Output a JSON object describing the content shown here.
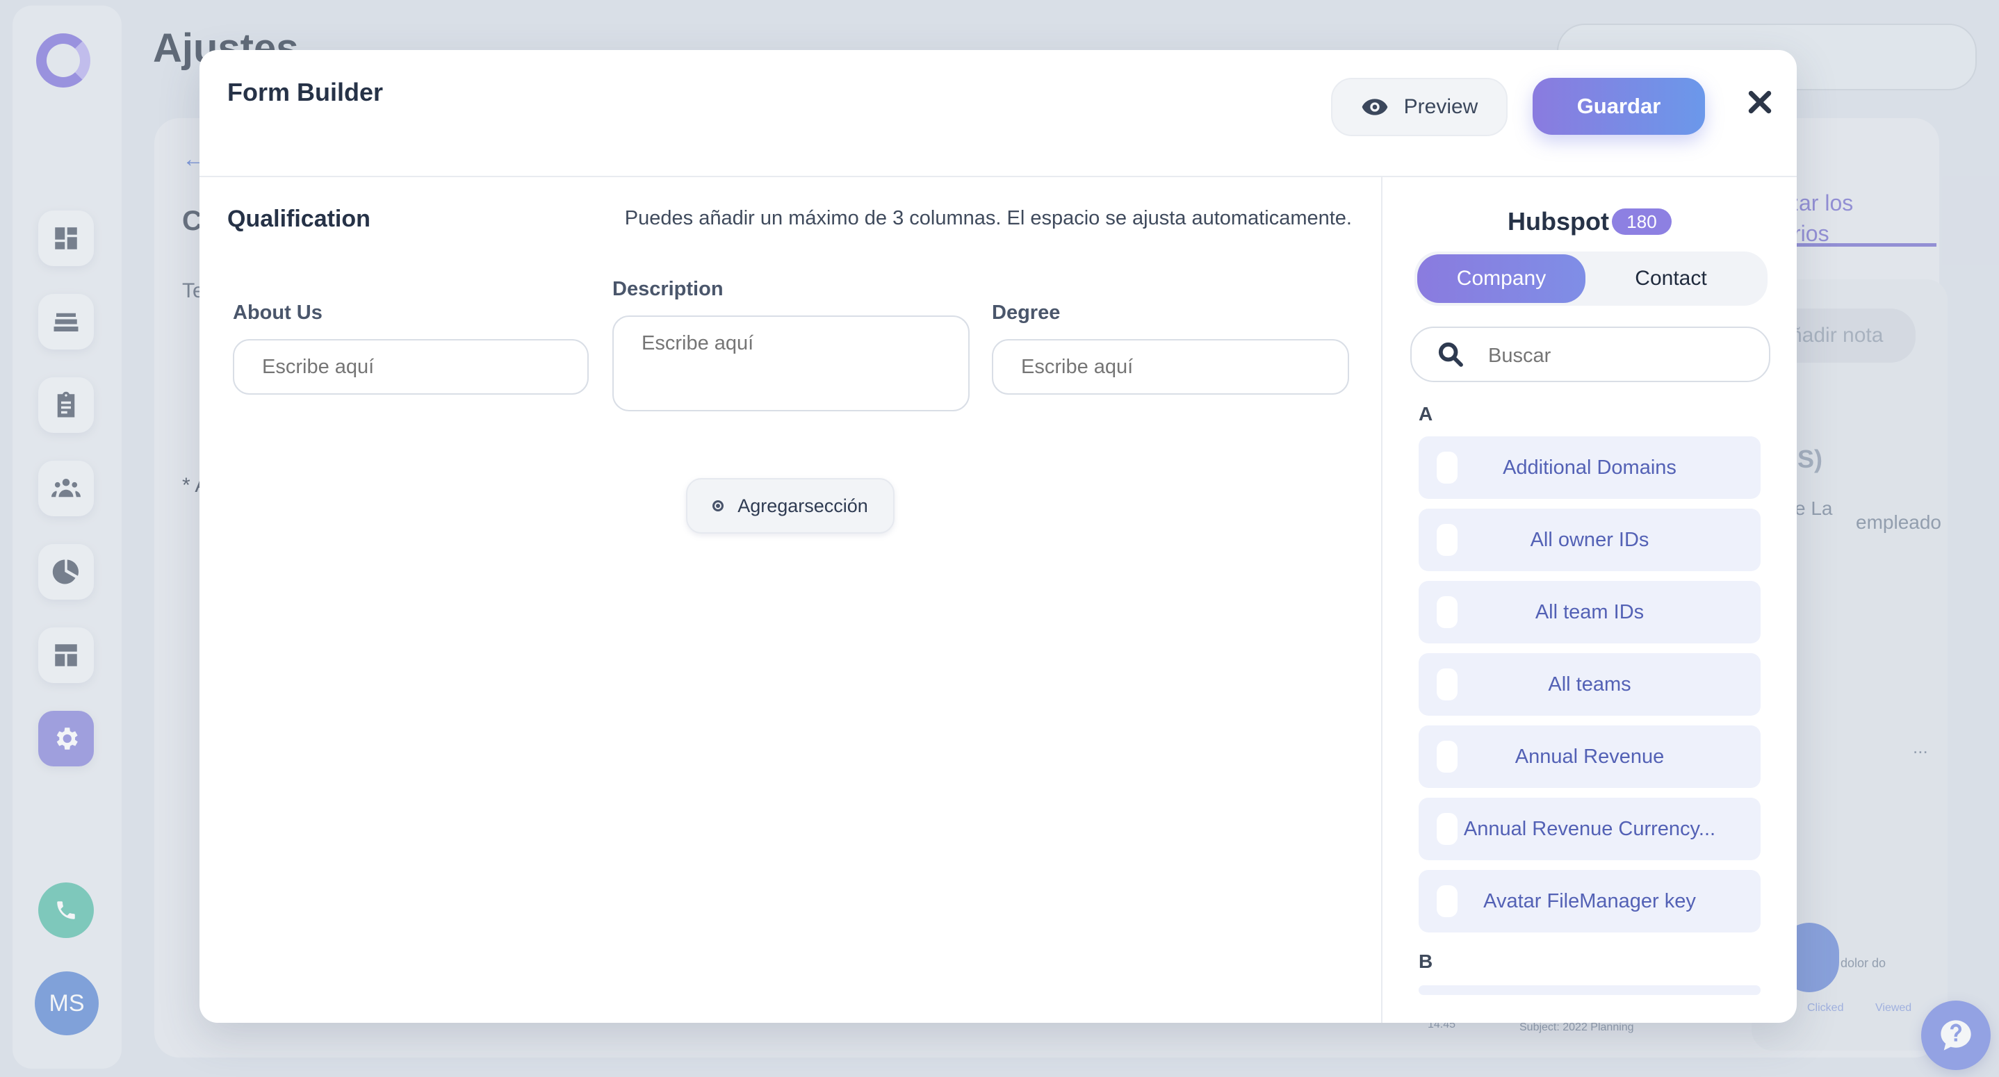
{
  "background": {
    "page_title": "Ajustes",
    "partial_texts": {
      "arrow": "←",
      "c_letter": "C",
      "te_letters": "Te",
      "asterisk": "* A",
      "link_line1": "zar los",
      "link_line2": "rios",
      "note_button": "ñadir nota",
      "paren": "S)",
      "e_la": "e La",
      "empleado": "empleado",
      "dots": "...",
      "dolor": "dolor do",
      "clicked": "Clicked",
      "viewed": "Viewed",
      "time": "14:45",
      "subject": "Subject: 2022 Planning"
    },
    "avatar_initials": "MS",
    "nav_icons": [
      "dashboard-icon",
      "layers-icon",
      "clipboard-icon",
      "team-icon",
      "pie-chart-icon",
      "layout-icon",
      "gear-icon"
    ]
  },
  "modal": {
    "title": "Form Builder",
    "preview_label": "Preview",
    "save_label": "Guardar",
    "section": {
      "title": "Qualification",
      "hint": "Puedes añadir un máximo de 3 columnas. El espacio se ajusta automaticamente.",
      "fields": [
        {
          "label": "About Us",
          "placeholder": "Escribe aquí"
        },
        {
          "label": "Description",
          "placeholder": "Escribe aquí"
        },
        {
          "label": "Degree",
          "placeholder": "Escribe aquí"
        }
      ],
      "add_section_label": "Agregarsección"
    },
    "hubspot": {
      "title": "Hubspot",
      "count": "180",
      "tabs": [
        "Company",
        "Contact"
      ],
      "active_tab": "Company",
      "search_placeholder": "Buscar",
      "groups": [
        {
          "letter": "A",
          "items": [
            "Additional Domains",
            "All owner IDs",
            "All team IDs",
            "All teams",
            "Annual Revenue",
            "Annual Revenue Currency...",
            "Avatar FileManager key"
          ]
        },
        {
          "letter": "B",
          "items": []
        }
      ]
    }
  },
  "colors": {
    "accent": "#8a7bdf",
    "accent_blue": "#6b98ea",
    "property_text": "#5361b5",
    "property_bg": "#eef1fb"
  }
}
